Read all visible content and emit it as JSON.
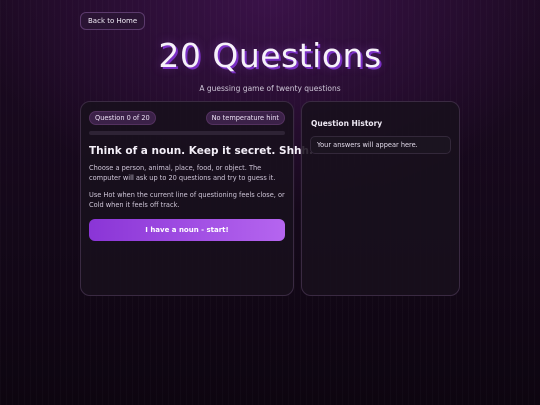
{
  "nav": {
    "back_label": "Back to Home"
  },
  "header": {
    "title": "20 Questions",
    "subtitle": "A guessing game of twenty questions"
  },
  "game": {
    "question_count_label": "Question 0 of 20",
    "temperature_hint": "No temperature hint",
    "progress": 0,
    "heading": "Think of a noun. Keep it secret. Shhh.",
    "instructions": "Choose a person, animal, place, food, or object. The computer will ask up to 20 questions and try to guess it.",
    "hint_instructions": "Use Hot when the current line of questioning feels close, or Cold when it feels off track.",
    "start_label": "I have a noun - start!"
  },
  "history": {
    "title": "Question History",
    "empty_message": "Your answers will appear here."
  },
  "colors": {
    "accent": "#9a4fe0",
    "button_start": "#8a35d6",
    "button_end": "#b565ef"
  }
}
